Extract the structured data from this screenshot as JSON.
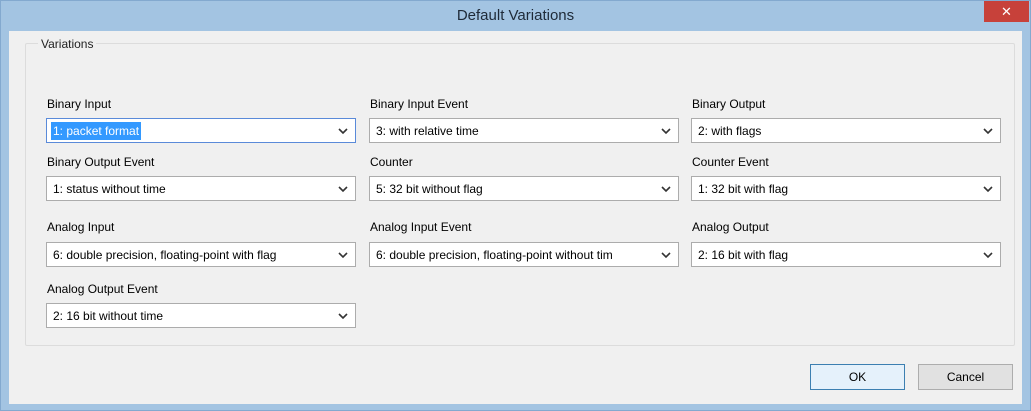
{
  "window": {
    "title": "Default Variations",
    "close_glyph": "✕"
  },
  "group": {
    "label": "Variations"
  },
  "fields": [
    {
      "label": "Binary Input",
      "value": "1: packet format"
    },
    {
      "label": "Binary Input Event",
      "value": "3: with relative time"
    },
    {
      "label": "Binary Output",
      "value": "2: with flags"
    },
    {
      "label": "Binary Output Event",
      "value": "1: status without time"
    },
    {
      "label": "Counter",
      "value": "5: 32 bit without flag"
    },
    {
      "label": "Counter Event",
      "value": "1: 32 bit with flag"
    },
    {
      "label": "Analog Input",
      "value": "6: double precision, floating-point with flag"
    },
    {
      "label": "Analog Input Event",
      "value": "6: double precision, floating-point without tim"
    },
    {
      "label": "Analog Output",
      "value": "2: 16 bit with flag"
    },
    {
      "label": "Analog Output Event",
      "value": "2: 16 bit without time"
    }
  ],
  "buttons": {
    "ok": "OK",
    "cancel": "Cancel"
  },
  "colors": {
    "titlebar": "#a3c4e2",
    "close": "#c7413a",
    "selection": "#3399ff"
  },
  "icons": {
    "dropdown": "chevron-down-icon",
    "close": "close-icon"
  }
}
